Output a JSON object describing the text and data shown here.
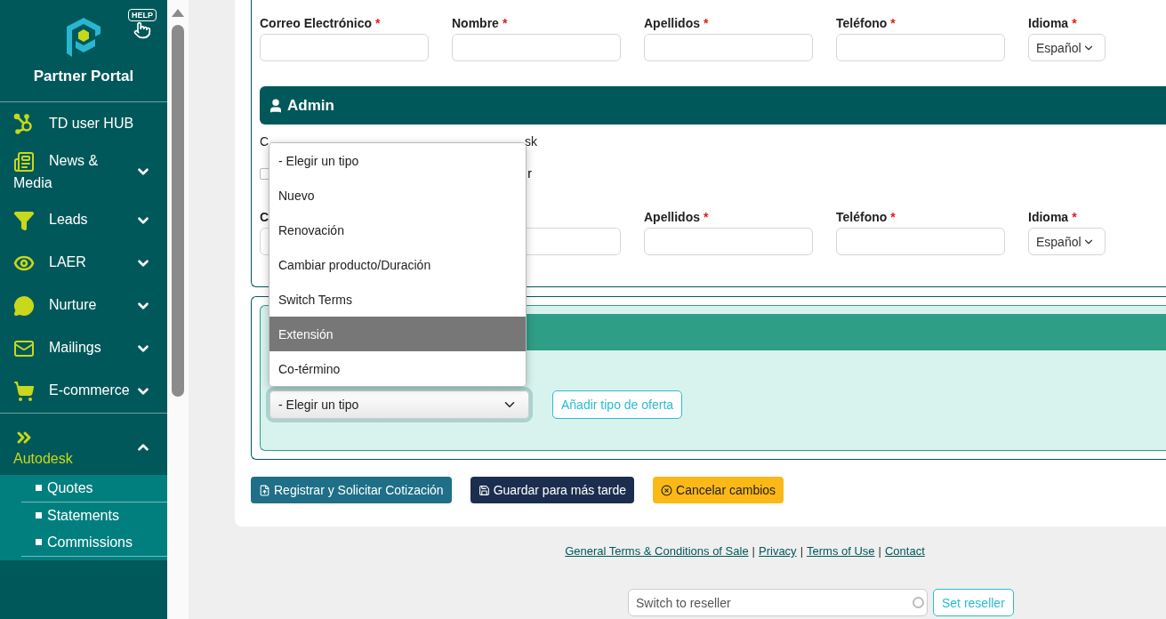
{
  "sidebar": {
    "help_badge": "HELP",
    "brand": "Partner Portal",
    "items": [
      {
        "label": "TD user HUB",
        "kind": "link",
        "active": false
      },
      {
        "label": "News & Media",
        "kind": "group",
        "expanded": false,
        "active": false
      },
      {
        "label": "Leads",
        "kind": "group",
        "expanded": false,
        "active": false
      },
      {
        "label": "LAER",
        "kind": "group",
        "expanded": false,
        "active": false
      },
      {
        "label": "Nurture",
        "kind": "group",
        "expanded": false,
        "active": false
      },
      {
        "label": "Mailings",
        "kind": "group",
        "expanded": false,
        "active": false
      },
      {
        "label": "E-commerce",
        "kind": "group",
        "expanded": false,
        "active": false
      },
      {
        "label": "Autodesk",
        "kind": "group",
        "expanded": true,
        "active": true,
        "children": [
          {
            "label": "Quotes"
          },
          {
            "label": "Statements"
          },
          {
            "label": "Commissions"
          }
        ]
      }
    ]
  },
  "contact_fields": [
    {
      "label": "Correo Electrónico",
      "required_mark": "*",
      "kind": "text"
    },
    {
      "label": "Nombre",
      "required_mark": "*",
      "kind": "text"
    },
    {
      "label": "Apellidos",
      "required_mark": "*",
      "kind": "text"
    },
    {
      "label": "Teléfono",
      "required_mark": "*",
      "kind": "text"
    },
    {
      "label": "Idioma",
      "required_mark": "*",
      "kind": "select",
      "value": "Español"
    }
  ],
  "admin": {
    "title": "Admin",
    "note_fragments": [
      "C",
      "sk"
    ],
    "checkbox": {
      "checked": false,
      "label_fragment": "r"
    },
    "fields": [
      {
        "label": "C",
        "kind": "text"
      },
      {
        "kind": "text"
      },
      {
        "label": "Apellidos",
        "required_mark": "*",
        "kind": "text"
      },
      {
        "label": "Teléfono",
        "required_mark": "*",
        "kind": "text"
      },
      {
        "label": "Idioma",
        "required_mark": "*",
        "kind": "select",
        "value": "Español"
      }
    ]
  },
  "offer": {
    "select_value": "- Elegir un tipo",
    "add_button": "Añadir tipo de oferta",
    "dropdown_options": [
      {
        "label": "- Elegir un tipo",
        "selected": false
      },
      {
        "label": "Nuevo",
        "selected": false
      },
      {
        "label": "Renovación",
        "selected": false
      },
      {
        "label": "Cambiar producto/Duración",
        "selected": false
      },
      {
        "label": "Switch Terms",
        "selected": false
      },
      {
        "label": "Extensión",
        "selected": true
      },
      {
        "label": "Co-término",
        "selected": false
      }
    ]
  },
  "actions": [
    {
      "label": "Registrar y Solicitar Cotización",
      "kind": "register"
    },
    {
      "label": "Guardar para más tarde",
      "kind": "save"
    },
    {
      "label": "Cancelar cambios",
      "kind": "cancel"
    }
  ],
  "footer": {
    "links": [
      "General Terms & Conditions of Sale",
      "Privacy",
      "Terms of Use",
      "Contact"
    ],
    "separator": "|"
  },
  "reseller": {
    "placeholder": "Switch to reseller",
    "button": "Set reseller"
  }
}
